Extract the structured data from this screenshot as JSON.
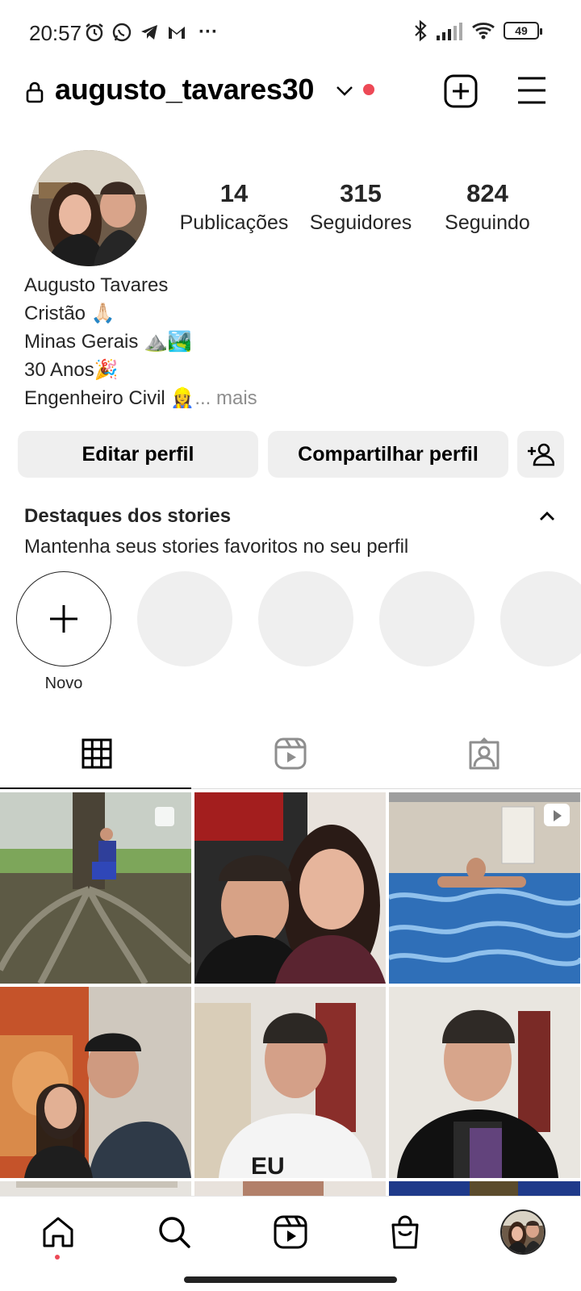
{
  "status_bar": {
    "time": "20:57",
    "more": "···",
    "battery": "49"
  },
  "header": {
    "username": "augusto_tavares30"
  },
  "profile": {
    "stats": [
      {
        "value": "14",
        "label": "Publicações"
      },
      {
        "value": "315",
        "label": "Seguidores"
      },
      {
        "value": "824",
        "label": "Seguindo"
      }
    ],
    "bio": {
      "name": "Augusto Tavares",
      "line1": "Cristão 🙏🏻",
      "line2": "Minas Gerais ⛰️🏞️",
      "line3": "30 Anos🎉",
      "line4": "Engenheiro Civil 👷‍♀️",
      "more": "... mais"
    }
  },
  "buttons": {
    "edit": "Editar perfil",
    "share": "Compartilhar perfil"
  },
  "highlights": {
    "title": "Destaques dos stories",
    "subtitle": "Mantenha seus stories favoritos no seu perfil",
    "new_label": "Novo"
  },
  "colors": {
    "notification": "#ed4956",
    "button_bg": "#efefef",
    "text": "#262626"
  }
}
